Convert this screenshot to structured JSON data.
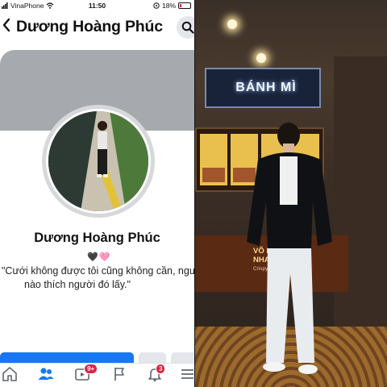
{
  "status_bar": {
    "carrier": "VinaPhone",
    "time": "11:50",
    "battery": "18%"
  },
  "profile": {
    "title": "Dương Hoàng Phúc",
    "name": "Dương Hoàng Phúc",
    "hearts": "🖤🩷",
    "bio_line1": "\"Cưới không được tôi cũng không cần, người",
    "bio_line2": "nào thích người đó lấy.\""
  },
  "tabbar": {
    "items": [
      "home-icon",
      "friends-icon",
      "watch-icon",
      "pages-icon",
      "notifications-icon",
      "menu-icon"
    ],
    "watch_badge": "9+",
    "notifications_badge": "3",
    "active_color": "#1877f2"
  },
  "photo": {
    "shop_sign": "BÁNH MÌ",
    "counter_line1": "VÕ NON",
    "counter_line2": "NHAN NOR",
    "counter_small": "Crispy hot cr"
  },
  "colors": {
    "facebook_blue": "#1877f2",
    "badge_red": "#e41e3f"
  }
}
